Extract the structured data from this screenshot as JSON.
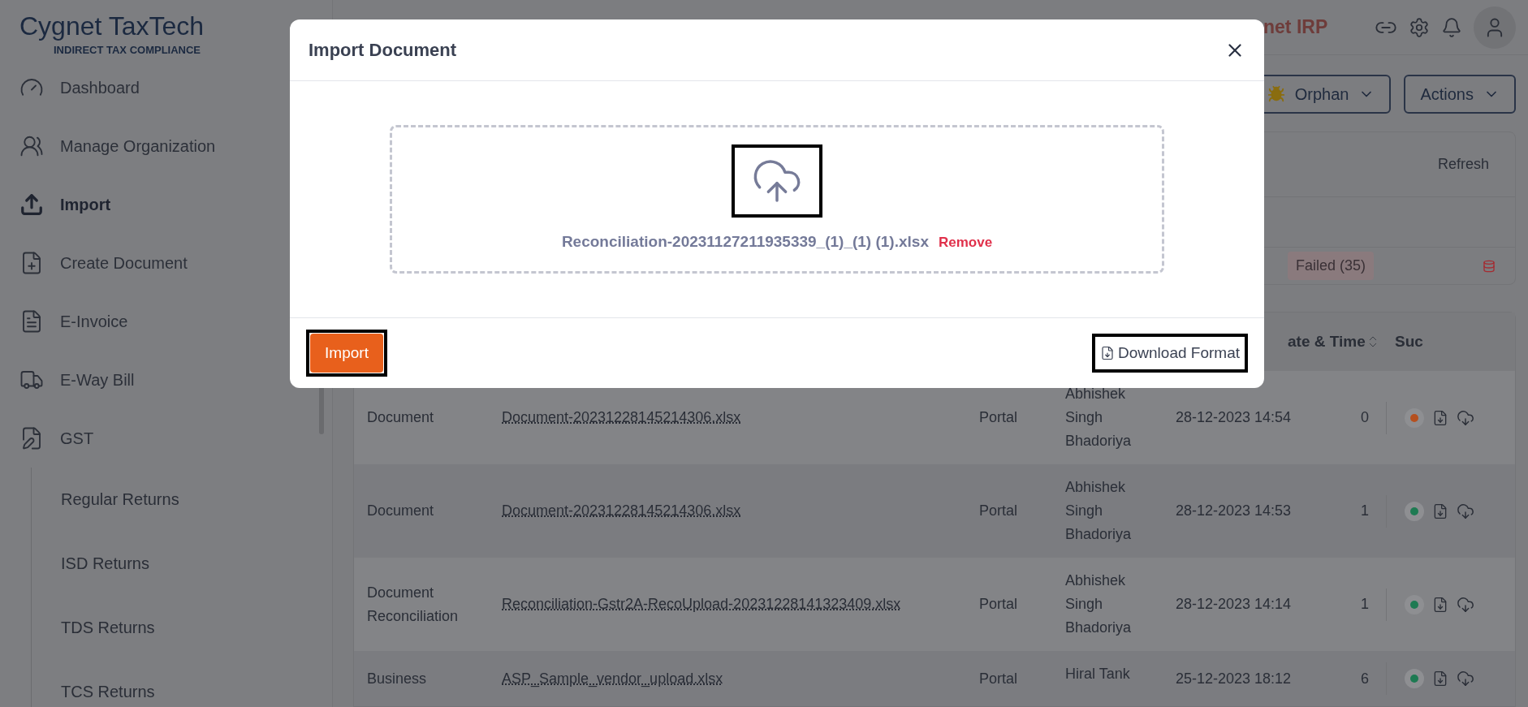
{
  "sidebar": {
    "logo": {
      "title": "Cygnet TaxTech",
      "subtitle": "INDIRECT TAX COMPLIANCE"
    },
    "items": [
      {
        "label": "Dashboard",
        "selected": false
      },
      {
        "label": "Manage Organization",
        "selected": false
      },
      {
        "label": "Import",
        "selected": true
      },
      {
        "label": "Create Document",
        "selected": false
      },
      {
        "label": "E-Invoice",
        "selected": false
      },
      {
        "label": "E-Way Bill",
        "selected": false
      },
      {
        "label": "GST",
        "selected": false,
        "expanded": true,
        "children": [
          {
            "label": "Regular Returns",
            "selected": false
          },
          {
            "label": "ISD Returns",
            "selected": false
          },
          {
            "label": "TDS Returns",
            "selected": false
          },
          {
            "label": "TCS Returns",
            "selected": false
          }
        ]
      }
    ]
  },
  "top_bar": {
    "product": "net IRP"
  },
  "toolbar": {
    "buttons": [
      {
        "label": "Orphan",
        "kind": "bug"
      },
      {
        "label": "Actions",
        "kind": "plain"
      }
    ]
  },
  "summary_card": {
    "refresh": "Refresh",
    "badge": "Failed (35)"
  },
  "table": {
    "columns": [
      "ate & Time",
      "Suc"
    ],
    "rows": [
      {
        "type": "Document",
        "file": "Document-20231228145214306.xlsx",
        "source": "Portal",
        "user": "Abhishek Singh Bhadoriya",
        "date": "28-12-2023 14:54",
        "count": "0",
        "color": "#b5501f"
      },
      {
        "type": "Document",
        "file": "Document-20231228145214306.xlsx",
        "source": "Portal",
        "user": "Abhishek Singh Bhadoriya",
        "date": "28-12-2023 14:53",
        "count": "1",
        "color": "#1e7a52"
      },
      {
        "type": "Document Reconciliation",
        "file": "Reconciliation-Gstr2A-RecoUpload-20231228141323409.xlsx",
        "source": "Portal",
        "user": "Abhishek Singh Bhadoriya",
        "date": "28-12-2023 14:14",
        "count": "1",
        "color": "#1e7a52"
      },
      {
        "type": "Business",
        "file": "ASP_Sample_vendor_upload.xlsx",
        "source": "Portal",
        "user": "Hiral Tank",
        "date": "25-12-2023 18:12",
        "count": "6",
        "color": "#1e7a52"
      }
    ]
  },
  "dialog": {
    "title": "Import Document",
    "file_name": "Reconciliation-20231127211935339_(1)_(1) (1).xlsx",
    "remove": "Remove",
    "import_button": "Import",
    "download": "Download Format"
  }
}
